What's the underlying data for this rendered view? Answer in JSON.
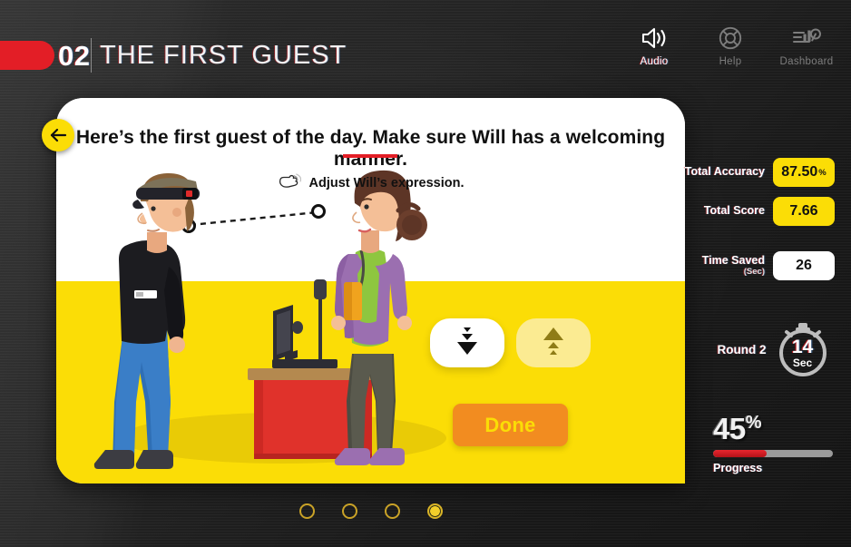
{
  "header": {
    "number": "02",
    "title": "THE FIRST GUEST",
    "tools": [
      {
        "label": "Audio",
        "icon": "speaker-icon",
        "state": "active"
      },
      {
        "label": "Help",
        "icon": "life-ring-icon",
        "state": "dim"
      },
      {
        "label": "Dashboard",
        "icon": "dashboard-chart-icon",
        "state": "dim"
      }
    ]
  },
  "card": {
    "back_label": "back",
    "heading": "Here’s the first guest of the day. Make sure Will has a welcoming manner.",
    "instruction": "Adjust Will’s expression.",
    "instruction_icon": "pointing-hand-icon",
    "controls": {
      "decrease_icon": "triple-chevron-down-icon",
      "increase_icon": "triple-chevron-up-icon",
      "done_label": "Done"
    }
  },
  "pagination": {
    "dots": [
      {
        "active": false
      },
      {
        "active": false
      },
      {
        "active": false
      },
      {
        "active": true
      }
    ]
  },
  "sidebar": {
    "stats": [
      {
        "label": "Total Accuracy",
        "sublabel": "",
        "value": "87.50",
        "suffix": "%",
        "box": "yellow"
      },
      {
        "label": "Total Score",
        "sublabel": "",
        "value": "7.66",
        "suffix": "",
        "box": "yellow"
      },
      {
        "label": "Time Saved",
        "sublabel": "(Sec)",
        "value": "26",
        "suffix": "",
        "box": "white"
      }
    ],
    "round": {
      "label": "Round 2",
      "timer_value": "14",
      "timer_unit": "Sec",
      "icon": "stopwatch-icon"
    },
    "progress": {
      "value": "45",
      "suffix": "%",
      "label": "Progress",
      "percent": 45
    }
  },
  "colors": {
    "accent_yellow": "#fbdd06",
    "accent_red": "#e31e26",
    "accent_orange": "#f28c20",
    "background_dark": "#1f1f1f"
  }
}
